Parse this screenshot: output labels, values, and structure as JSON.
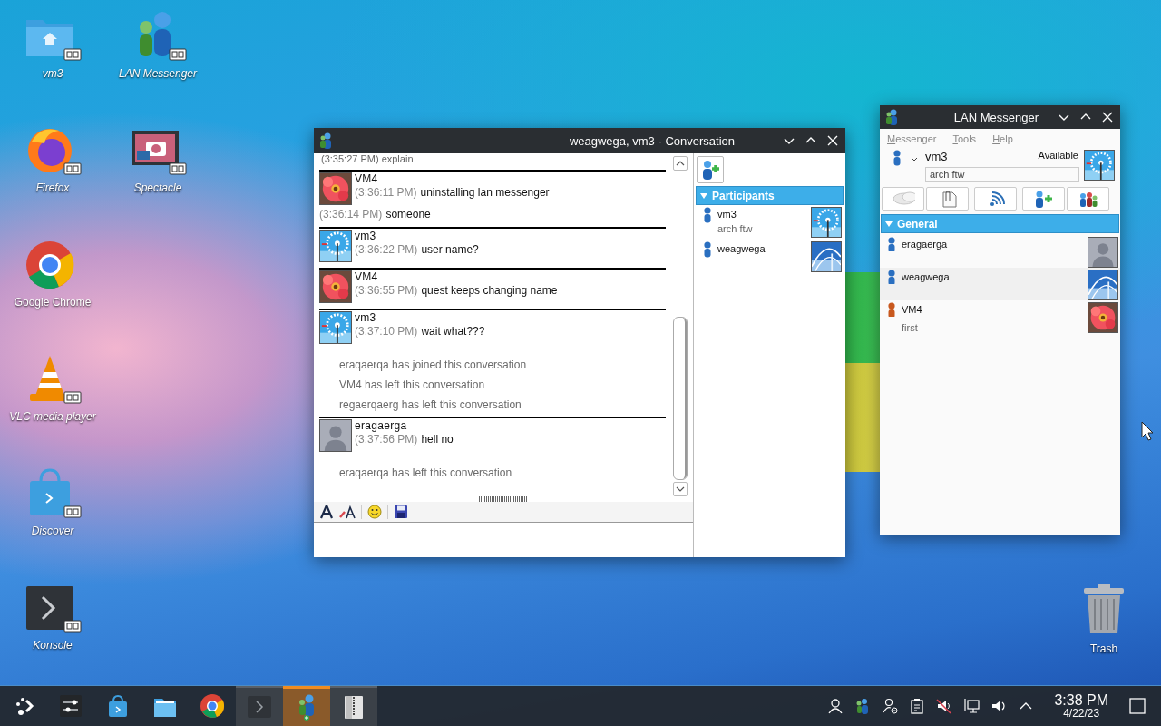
{
  "desktop_icons": [
    {
      "label": "vm3",
      "kind": "folder",
      "link": true
    },
    {
      "label": "Firefox",
      "kind": "firefox",
      "link": true
    },
    {
      "label": "Google Chrome",
      "kind": "chrome",
      "link": false
    },
    {
      "label": "VLC media player",
      "kind": "vlc",
      "link": true
    },
    {
      "label": "Discover",
      "kind": "discover",
      "link": true
    },
    {
      "label": "Konsole",
      "kind": "konsole",
      "link": true
    },
    {
      "label": "LAN Messenger",
      "kind": "messenger",
      "link": true
    },
    {
      "label": "Spectacle",
      "kind": "spectacle",
      "link": true
    }
  ],
  "trash": {
    "label": "Trash"
  },
  "conversation": {
    "title": "weagwega, vm3 - Conversation",
    "messages": [
      {
        "kind": "system",
        "text": "(3:35:27 PM) explain"
      },
      {
        "kind": "message",
        "sender": "VM4",
        "photo": true,
        "lines": [
          {
            "time": "(3:36:11 PM)",
            "text": "uninstalling lan messenger"
          }
        ]
      },
      {
        "kind": "followup",
        "time": "(3:36:14 PM)",
        "text": "someone"
      },
      {
        "kind": "message",
        "sender": "vm3",
        "photo": true,
        "lines": [
          {
            "time": "(3:36:22 PM)",
            "text": "user name?"
          }
        ]
      },
      {
        "kind": "message",
        "sender": "VM4",
        "photo": true,
        "lines": [
          {
            "time": "(3:36:55 PM)",
            "text": "quest keeps changing name"
          }
        ]
      },
      {
        "kind": "message",
        "sender": "vm3",
        "photo": true,
        "lines": [
          {
            "time": "(3:37:10 PM)",
            "text": "wait what???"
          }
        ]
      },
      {
        "kind": "notice",
        "text": "eraqaerqa has joined this conversation"
      },
      {
        "kind": "notice",
        "text": "VM4 has left this conversation"
      },
      {
        "kind": "notice",
        "text": "regaerqaerg has left this conversation"
      },
      {
        "kind": "message",
        "sender": "eragaerga",
        "photo": false,
        "lines": [
          {
            "time": "(3:37:56 PM)",
            "text": "hell no"
          }
        ]
      },
      {
        "kind": "notice",
        "text": "eraqaerqa has left this conversation"
      }
    ],
    "participants": {
      "title": "Participants",
      "expanded": true,
      "items": [
        {
          "name": "vm3",
          "note": "arch ftw",
          "color": "#2a6fc0",
          "photo": true
        },
        {
          "name": "weagwega",
          "color": "#2a6fc0",
          "photo": true
        }
      ]
    }
  },
  "messenger": {
    "title": "LAN Messenger",
    "menu": [
      "Messenger",
      "Tools",
      "Help"
    ],
    "user": {
      "name": "vm3",
      "status": "Available",
      "note": "arch ftw",
      "photo": true
    },
    "group": {
      "title": "General",
      "expanded": true,
      "contacts": [
        {
          "name": "eragaerga",
          "color": "#2a6fc0",
          "photo": false
        },
        {
          "name": "weagwega",
          "color": "#2a6fc0",
          "photo": true
        },
        {
          "name": "VM4",
          "note": "first",
          "color": "#c8581e",
          "photo": true
        }
      ]
    }
  },
  "taskbar": {
    "tasks": [
      {
        "kind": "launcher",
        "active": false
      },
      {
        "kind": "settings",
        "active": false
      },
      {
        "kind": "discover",
        "active": false
      },
      {
        "kind": "files",
        "active": false
      },
      {
        "kind": "chrome",
        "active": false
      },
      {
        "kind": "konsole",
        "active": false
      },
      {
        "kind": "messenger",
        "active": true
      },
      {
        "kind": "archive",
        "active": false
      }
    ],
    "clock": {
      "time": "3:38 PM",
      "date": "4/22/23"
    }
  }
}
